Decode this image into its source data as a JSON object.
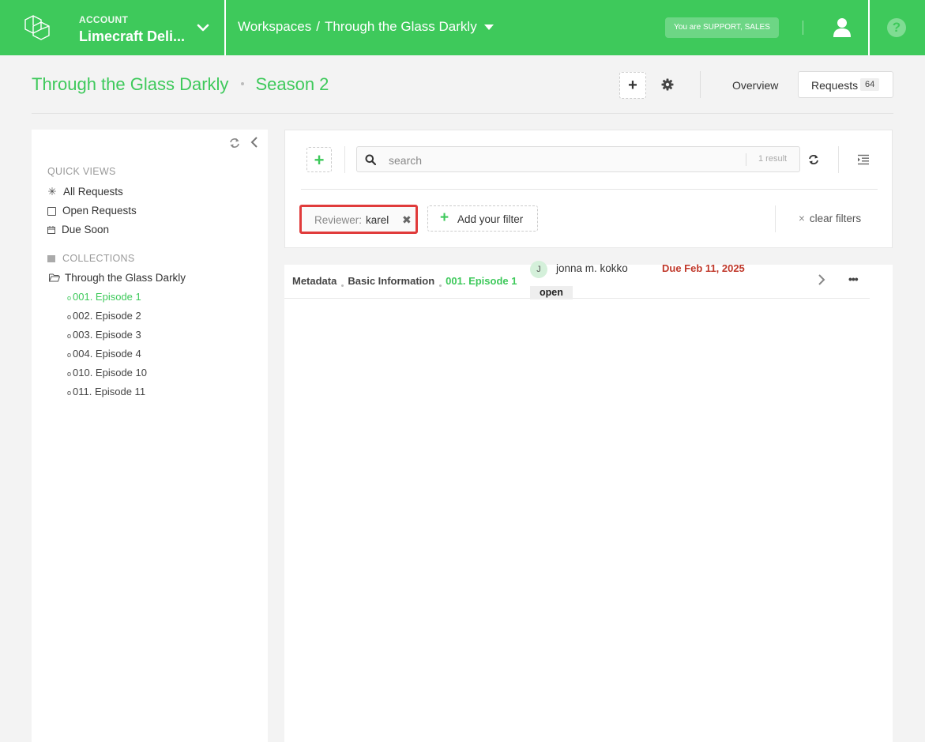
{
  "topbar": {
    "account_label": "ACCOUNT",
    "account_name": "Limecraft Deli...",
    "breadcrumb_root": "Workspaces",
    "breadcrumb_sep": "/",
    "breadcrumb_current": "Through the Glass Darkly",
    "role_badge": "You are SUPPORT, SALES",
    "help_glyph": "?",
    "brand_color": "#3ec95b"
  },
  "header": {
    "title": "Through the Glass Darkly",
    "subtitle": "Season 2",
    "add_glyph": "+",
    "nav_overview": "Overview",
    "nav_requests": "Requests",
    "requests_count": "64"
  },
  "sidebar": {
    "quick_views_title": "QUICK VIEWS",
    "quick_views": [
      {
        "label": "All Requests",
        "icon": "asterisk-icon"
      },
      {
        "label": "Open Requests",
        "icon": "checkbox-icon"
      },
      {
        "label": "Due Soon",
        "icon": "calendar-icon"
      }
    ],
    "collections_title": "COLLECTIONS",
    "collection_root": "Through the Glass Darkly",
    "collection_items": [
      {
        "label": "001. Episode 1",
        "active": true
      },
      {
        "label": "002. Episode 2",
        "active": false
      },
      {
        "label": "003. Episode 3",
        "active": false
      },
      {
        "label": "004. Episode 4",
        "active": false
      },
      {
        "label": "010. Episode 10",
        "active": false
      },
      {
        "label": "011. Episode 11",
        "active": false
      }
    ]
  },
  "toolbar": {
    "add_glyph": "+",
    "search_placeholder": "search",
    "result_count": "1 result"
  },
  "filters": {
    "chip_key": "Reviewer:",
    "chip_value": "karel",
    "chip_remove_glyph": "✖",
    "add_filter_label": "Add your filter",
    "add_filter_glyph": "+",
    "clear_filters_label": "clear filters",
    "clear_glyph": "×"
  },
  "results": [
    {
      "type": "Metadata",
      "section": "Basic Information",
      "collection": "001. Episode 1",
      "assignee_initial": "J",
      "assignee": "jonna m. kokko",
      "due": "Due Feb 11, 2025",
      "status": "open",
      "more_glyph": "•••"
    }
  ]
}
